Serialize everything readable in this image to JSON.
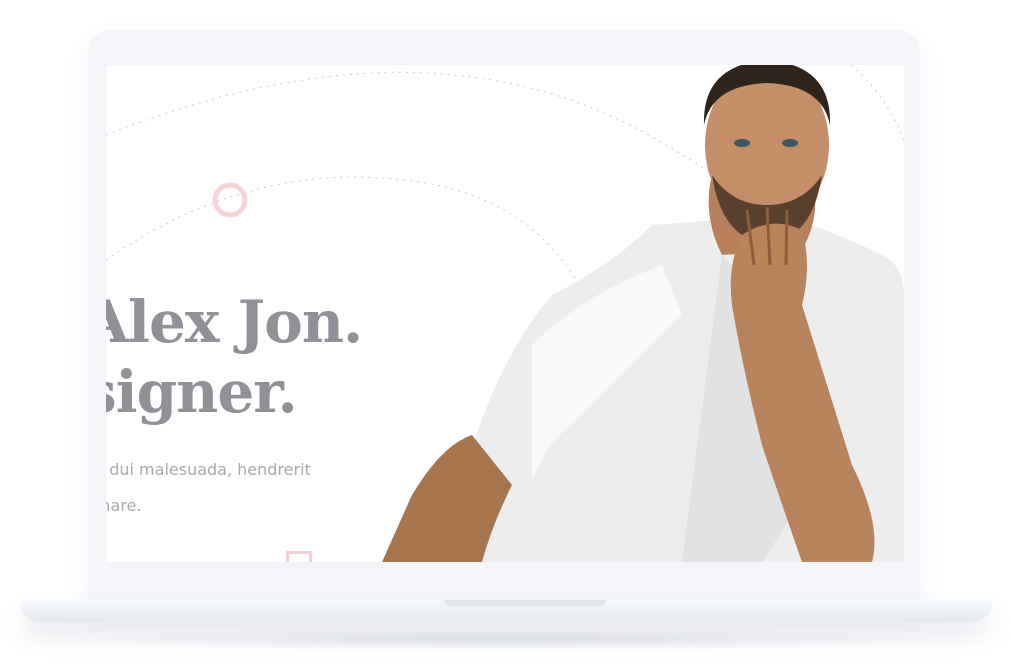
{
  "hero": {
    "headline_line1": "Alex Jon.",
    "headline_line2": "signer.",
    "lead_line1": "n dui malesuada, hendrerit",
    "lead_line2": "rnare."
  },
  "photo": {
    "description": "portrait-man-white-tshirt"
  },
  "colors": {
    "heading": "#8f9196",
    "body_text": "#a9abb0",
    "accent_pink": "#f3c8cd",
    "bezel": "#f3f5f8"
  }
}
